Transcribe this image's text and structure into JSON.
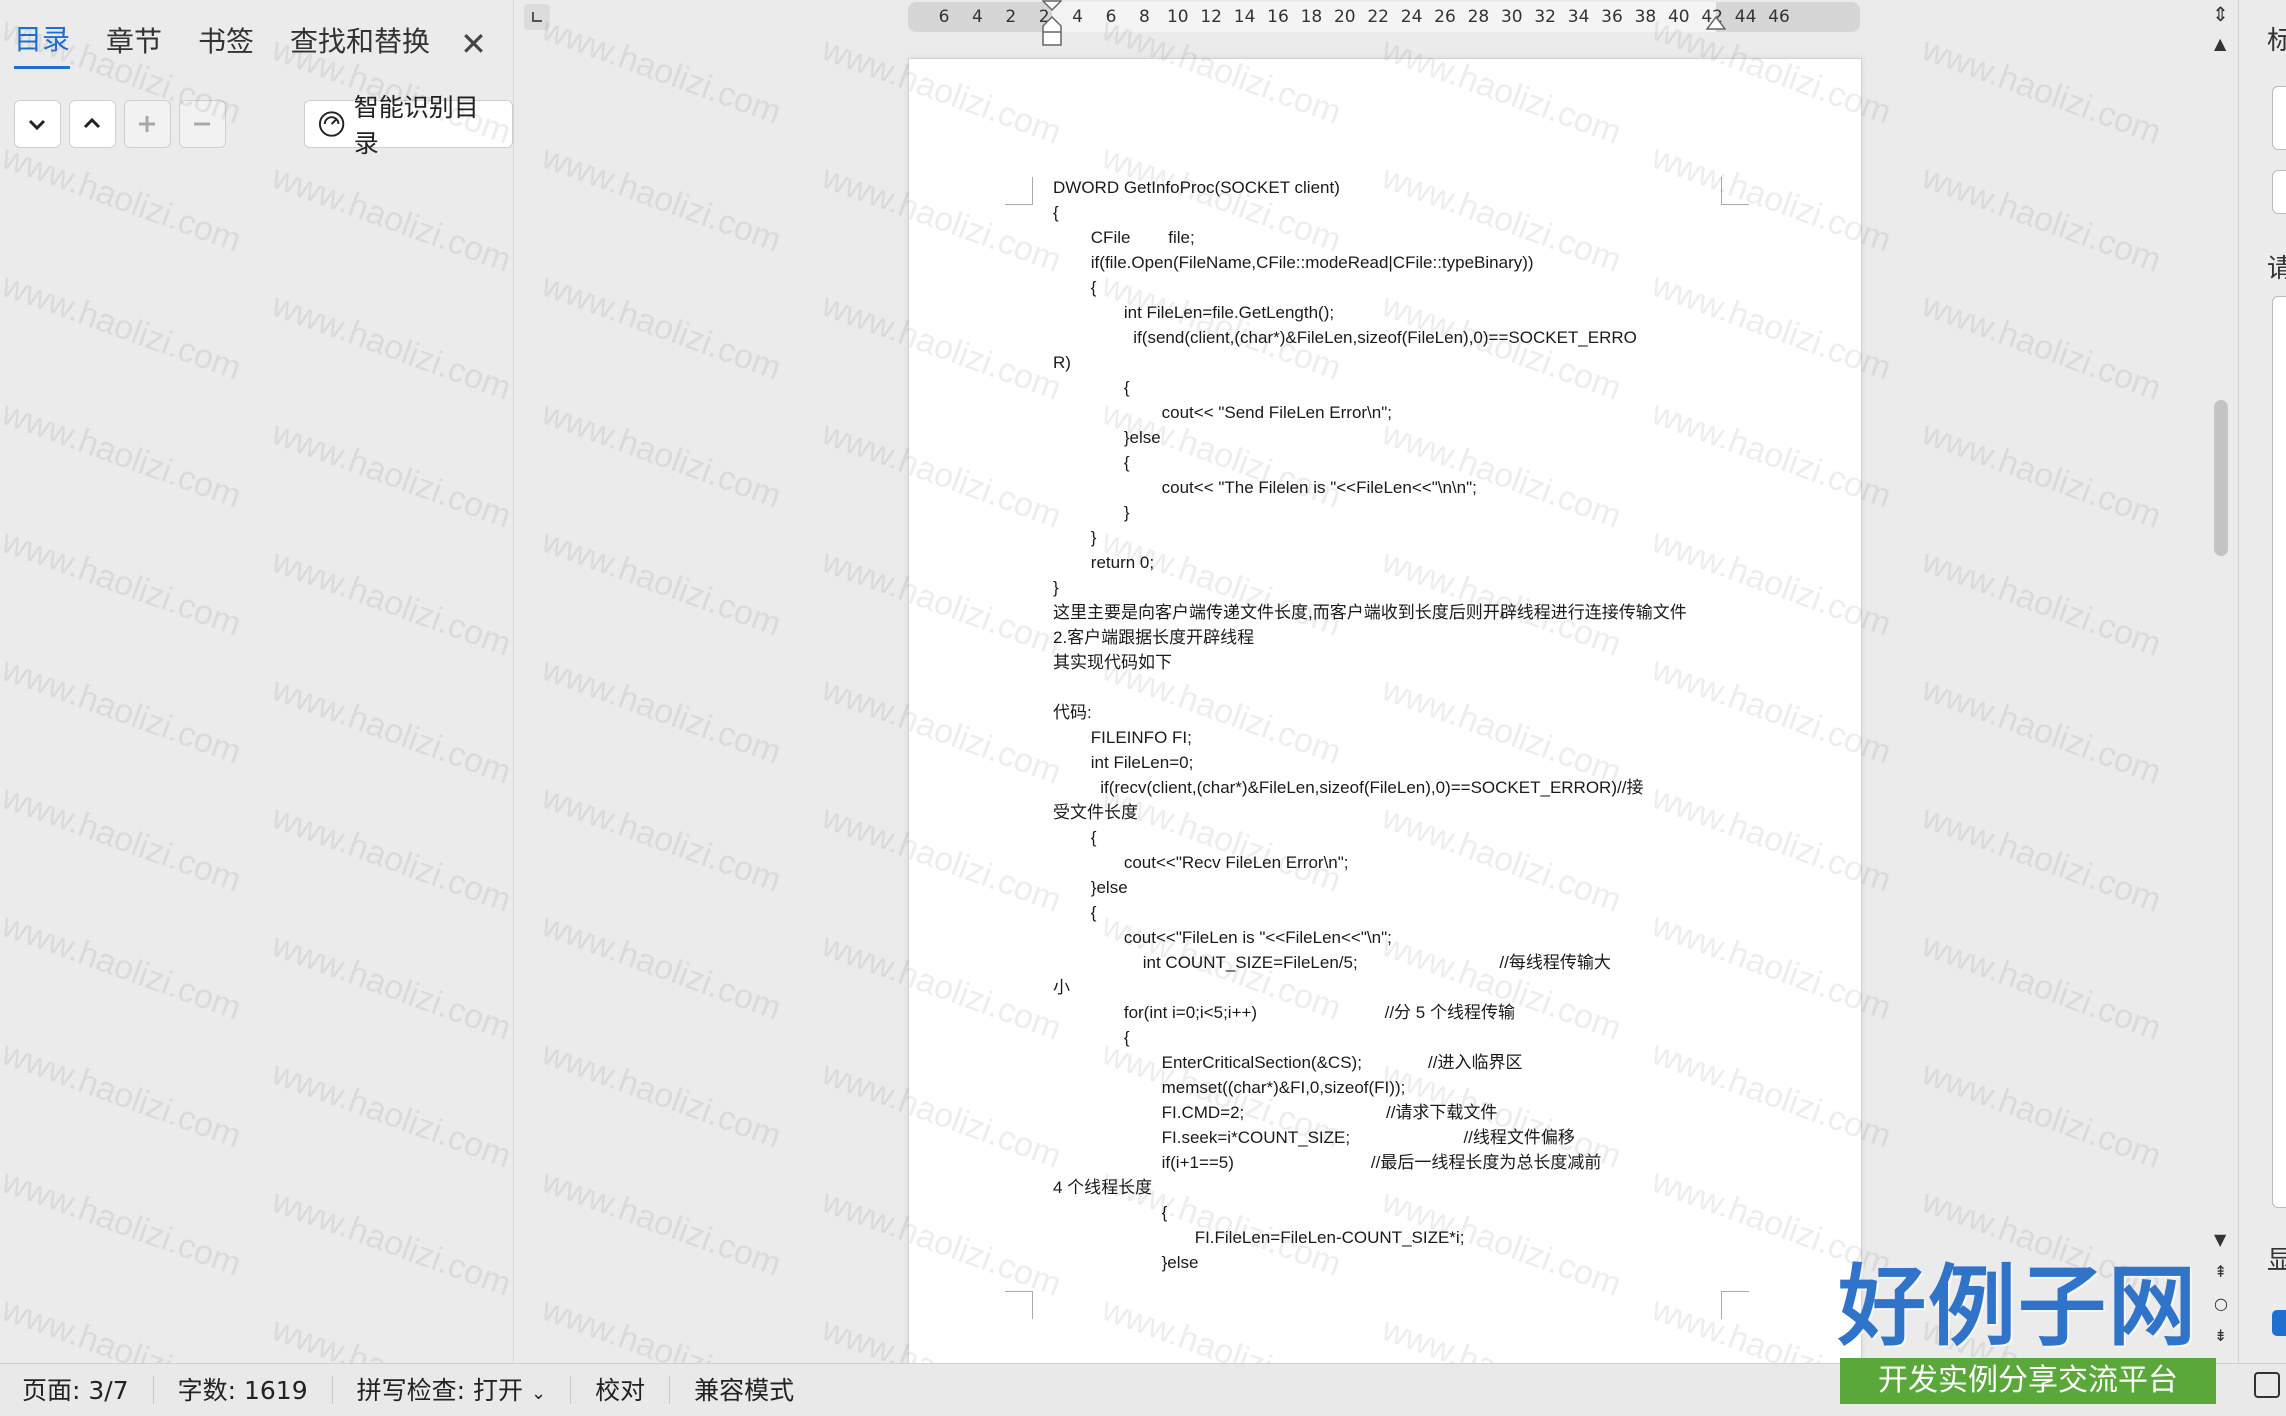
{
  "nav": {
    "tabs": [
      "目录",
      "章节",
      "书签",
      "查找和替换"
    ],
    "smart_button": "智能识别目录"
  },
  "ruler": {
    "ticks": [
      "6",
      "4",
      "2",
      "2",
      "4",
      "6",
      "8",
      "10",
      "12",
      "14",
      "16",
      "18",
      "20",
      "22",
      "24",
      "26",
      "28",
      "30",
      "32",
      "34",
      "36",
      "38",
      "40",
      "42",
      "44",
      "46"
    ]
  },
  "document": {
    "lines": [
      "DWORD GetInfoProc(SOCKET client)",
      "{",
      "        CFile        file;",
      "        if(file.Open(FileName,CFile::modeRead|CFile::typeBinary))",
      "        {",
      "               int FileLen=file.GetLength();",
      "                 if(send(client,(char*)&FileLen,sizeof(FileLen),0)==SOCKET_ERRO",
      "R)",
      "               {",
      "                       cout<< \"Send FileLen Error\\n\";",
      "               }else",
      "               {",
      "                       cout<< \"The Filelen is \"<<FileLen<<\"\\n\\n\";",
      "               }",
      "        }",
      "        return 0;",
      "}",
      "这里主要是向客户端传递文件长度,而客户端收到长度后则开辟线程进行连接传输文件",
      "2.客户端跟据长度开辟线程",
      "其实现代码如下",
      "",
      "代码:",
      "        FILEINFO FI;",
      "        int FileLen=0;",
      "          if(recv(client,(char*)&FileLen,sizeof(FileLen),0)==SOCKET_ERROR)//接",
      "受文件长度",
      "        {",
      "               cout<<\"Recv FileLen Error\\n\";",
      "        }else",
      "        {",
      "               cout<<\"FileLen is \"<<FileLen<<\"\\n\";",
      "                   int COUNT_SIZE=FileLen/5;                              //每线程传输大",
      "小",
      "               for(int i=0;i<5;i++)                           //分 5 个线程传输",
      "               {",
      "                       EnterCriticalSection(&CS);              //进入临界区",
      "                       memset((char*)&FI,0,sizeof(FI));",
      "                       FI.CMD=2;                              //请求下载文件",
      "                       FI.seek=i*COUNT_SIZE;                        //线程文件偏移",
      "                       if(i+1==5)                             //最后一线程长度为总长度减前",
      "4 个线程长度",
      "                       {",
      "                              FI.FileLen=FileLen-COUNT_SIZE*i;",
      "                       }else"
    ]
  },
  "watermark": "www.haolizi.com",
  "status": {
    "page": "页面: 3/7",
    "words": "字数: 1619",
    "spell": "拼写检查: 打开",
    "proof": "校对",
    "compat": "兼容模式"
  },
  "right_strip": {
    "top_glyph": "标",
    "mid_glyph": "请",
    "low_glyph": "显"
  },
  "brand": {
    "main": "好例子网",
    "sub": "开发实例分享交流平台"
  },
  "colors": {
    "accent": "#1f6fd1",
    "brand_blue": "#2f74c9",
    "brand_green": "#5aa83a"
  }
}
